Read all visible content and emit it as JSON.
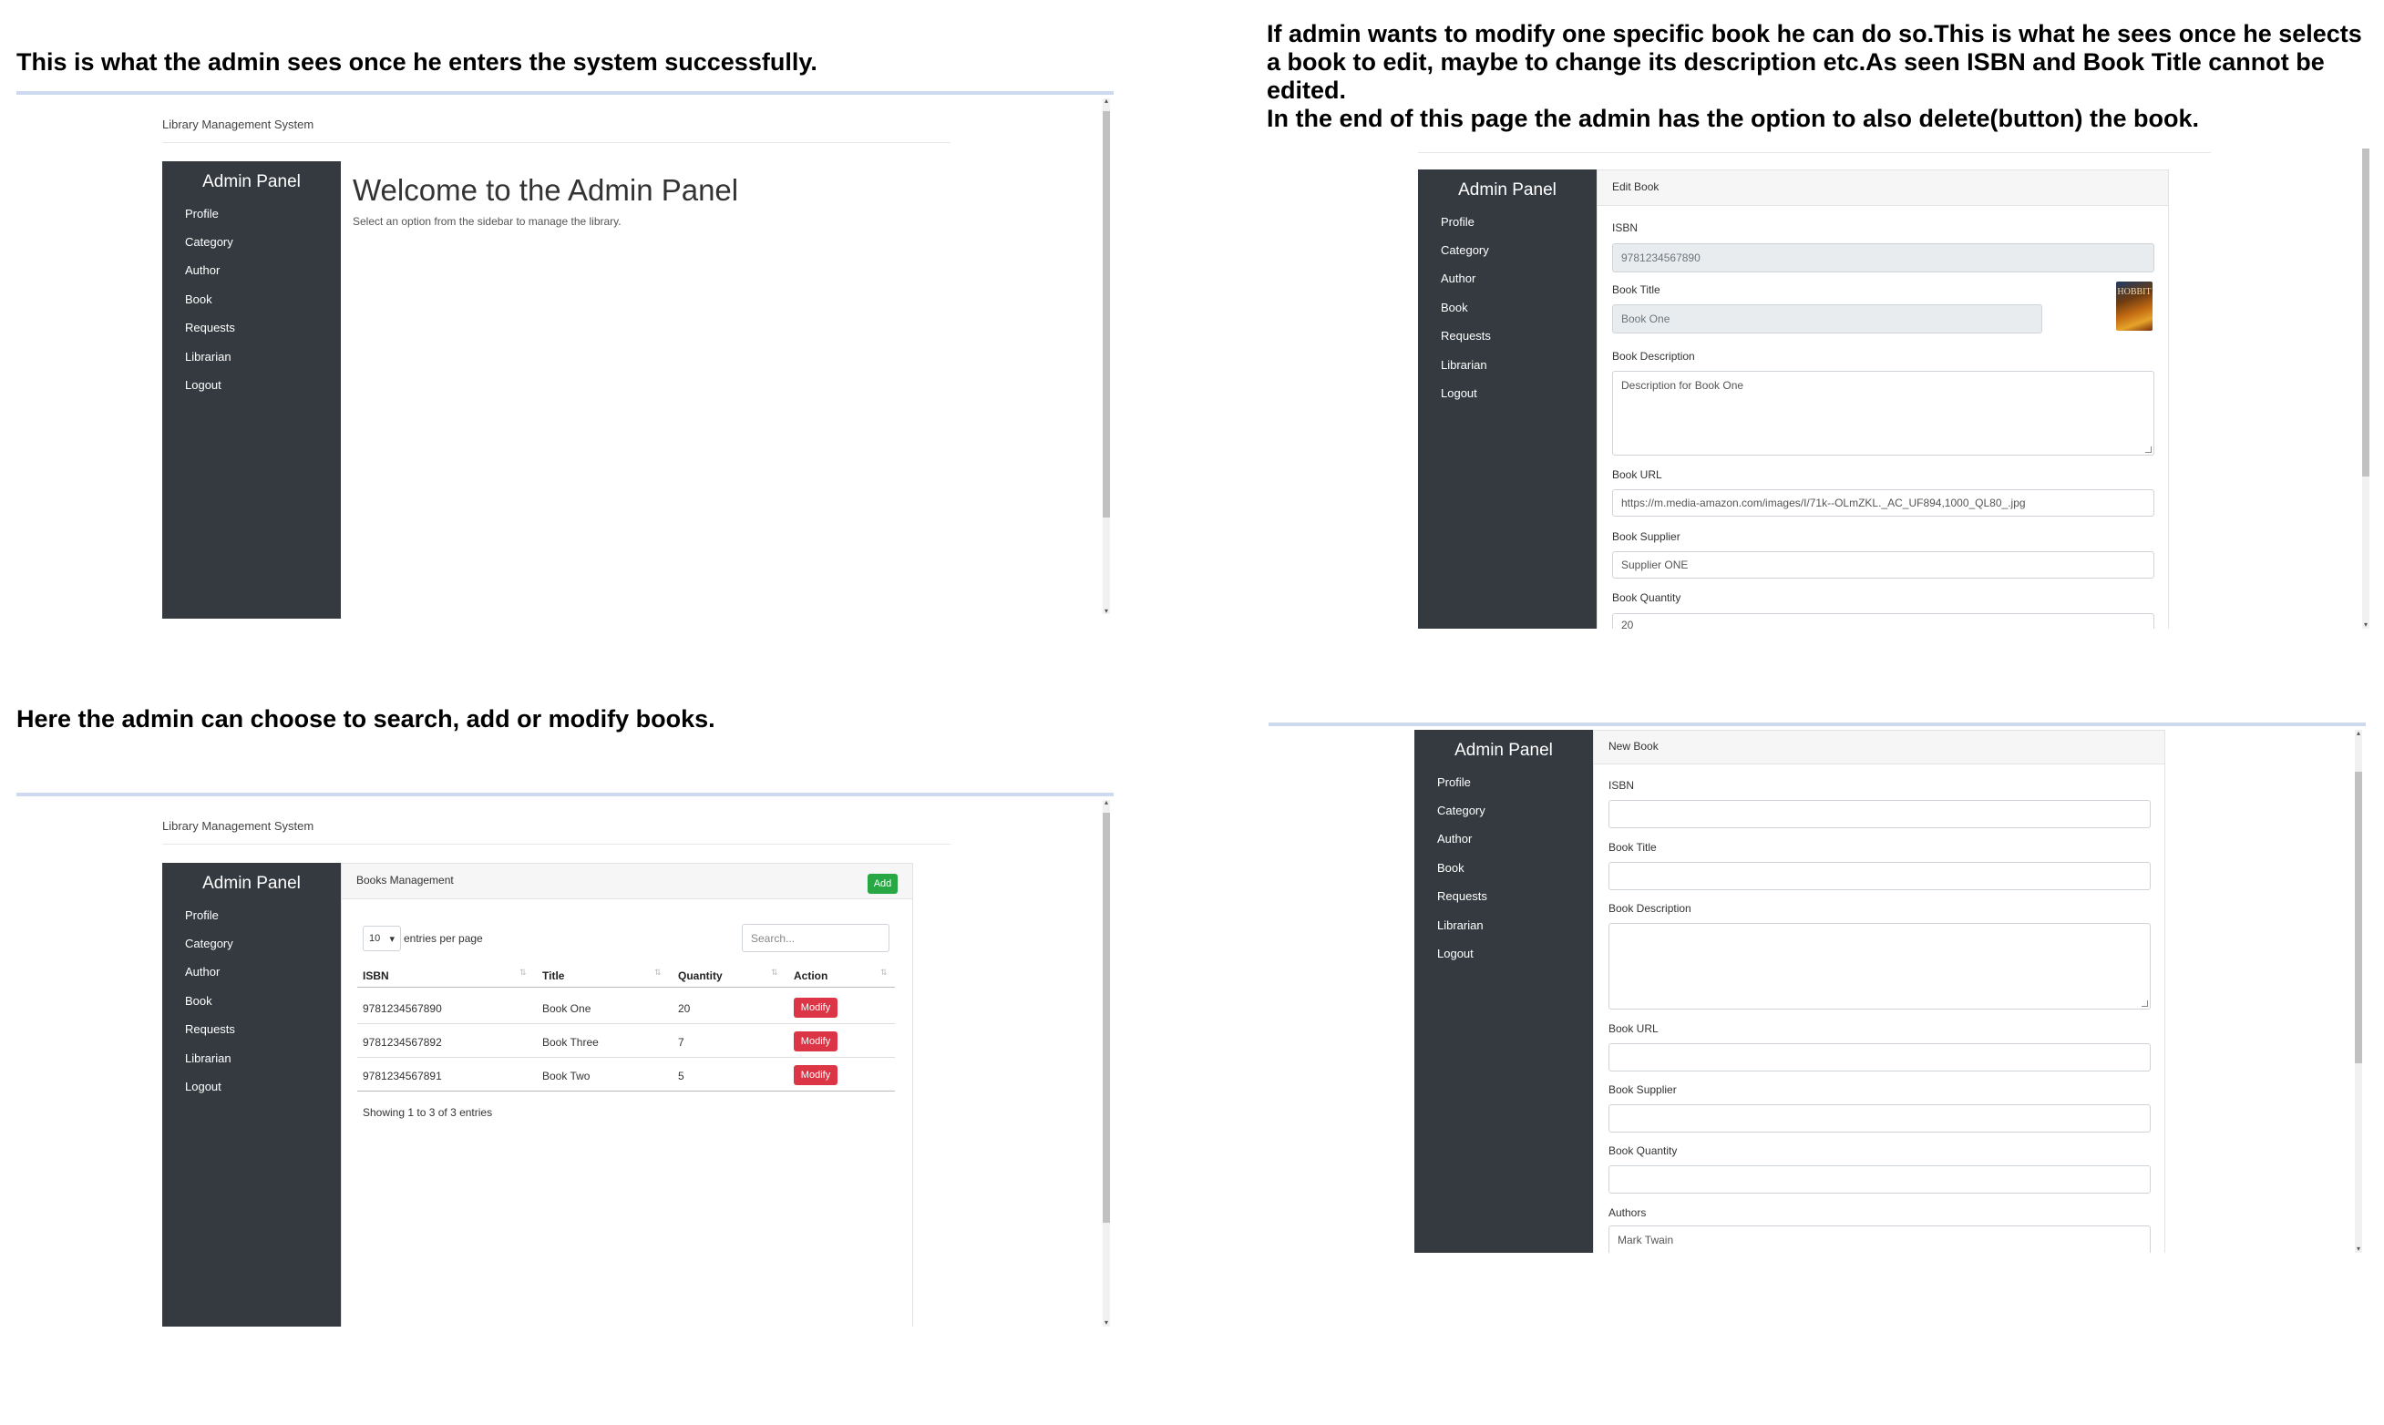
{
  "captions": {
    "admin_home": "This is what the admin sees once he enters the system successfully.",
    "edit_book": [
      "If admin wants to modify one specific book he can do so.This is what he sees once he selects",
      "a book to edit, maybe to change its description etc.As seen ISBN and Book Title cannot be",
      "edited.",
      "In the end of this page the admin has the option to also delete(button) the book."
    ],
    "books_management": "Here the admin can choose to search, add or modify books."
  },
  "app": {
    "brand": "Library Management System",
    "sidebar_title": "Admin Panel",
    "sidebar_items": [
      "Profile",
      "Category",
      "Author",
      "Book",
      "Requests",
      "Librarian",
      "Logout"
    ]
  },
  "home": {
    "heading": "Welcome to the Admin Panel",
    "subtitle": "Select an option from the sidebar to manage the library."
  },
  "edit_book": {
    "header": "Edit Book",
    "isbn_label": "ISBN",
    "isbn_value": "9781234567890",
    "title_label": "Book Title",
    "title_value": "Book One",
    "cover_text": "HOBBIT",
    "description_label": "Book Description",
    "description_value": "Description for Book One",
    "url_label": "Book URL",
    "url_value": "https://m.media-amazon.com/images/I/71k--OLmZKL._AC_UF894,1000_QL80_.jpg",
    "supplier_label": "Book Supplier",
    "supplier_value": "Supplier ONE",
    "quantity_label": "Book Quantity",
    "quantity_value": "20"
  },
  "books": {
    "header": "Books Management",
    "add_label": "Add",
    "page_size": "10",
    "page_size_caret": "▾",
    "entries_label": "entries per page",
    "search_placeholder": "Search...",
    "columns": [
      "ISBN",
      "Title",
      "Quantity",
      "Action"
    ],
    "rows": [
      {
        "isbn": "9781234567890",
        "title": "Book One",
        "quantity": "20",
        "action": "Modify"
      },
      {
        "isbn": "9781234567892",
        "title": "Book Three",
        "quantity": "7",
        "action": "Modify"
      },
      {
        "isbn": "9781234567891",
        "title": "Book Two",
        "quantity": "5",
        "action": "Modify"
      }
    ],
    "info": "Showing 1 to 3 of 3 entries"
  },
  "new_book": {
    "header": "New Book",
    "isbn_label": "ISBN",
    "title_label": "Book Title",
    "description_label": "Book Description",
    "url_label": "Book URL",
    "supplier_label": "Book Supplier",
    "quantity_label": "Book Quantity",
    "authors_label": "Authors",
    "authors_first": "Mark Twain"
  },
  "icons": {
    "sort": "⇅",
    "scroll_up": "▴",
    "scroll_down": "▾"
  },
  "colors": {
    "sidebar": "#343a40",
    "add_button": "#28a745",
    "modify_button": "#dc3545"
  }
}
